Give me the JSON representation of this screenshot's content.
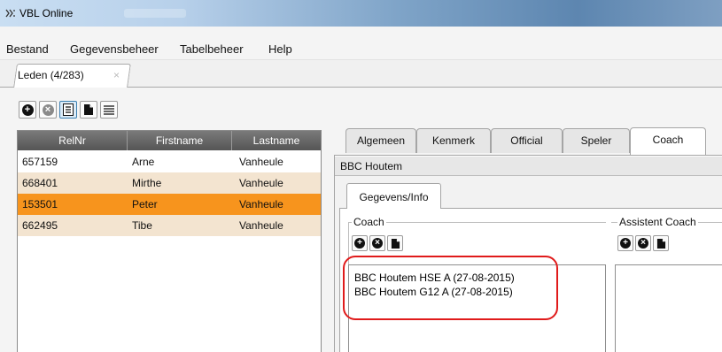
{
  "window": {
    "title": "VBL Online"
  },
  "menu": {
    "items": [
      "Bestand",
      "Gegevensbeheer",
      "Tabelbeheer",
      "Help"
    ]
  },
  "doc_tab": {
    "label": "Leden (4/283)",
    "close": "×"
  },
  "table": {
    "columns": [
      "RelNr",
      "Firstname",
      "Lastname"
    ],
    "rows": [
      {
        "relnr": "657159",
        "firstname": "Arne",
        "lastname": "Vanheule"
      },
      {
        "relnr": "668401",
        "firstname": "Mirthe",
        "lastname": "Vanheule"
      },
      {
        "relnr": "153501",
        "firstname": "Peter",
        "lastname": "Vanheule"
      },
      {
        "relnr": "662495",
        "firstname": "Tibe",
        "lastname": "Vanheule"
      }
    ]
  },
  "detail_tabs": [
    "Algemeen",
    "Kenmerk",
    "Official",
    "Speler",
    "Coach"
  ],
  "club": {
    "name": "BBC Houtem"
  },
  "inner_tab": {
    "label": "Gegevens/Info"
  },
  "coach": {
    "label": "Coach",
    "entries": [
      "BBC Houtem HSE A (27-08-2015)",
      "BBC Houtem G12 A (27-08-2015)"
    ]
  },
  "assistant": {
    "label": "Assistent Coach"
  },
  "colors": {
    "selected_row": "#f7941d",
    "alt_row": "#f3e4d0",
    "header": "#5e5e5e",
    "highlight_border": "#e01b1b"
  }
}
